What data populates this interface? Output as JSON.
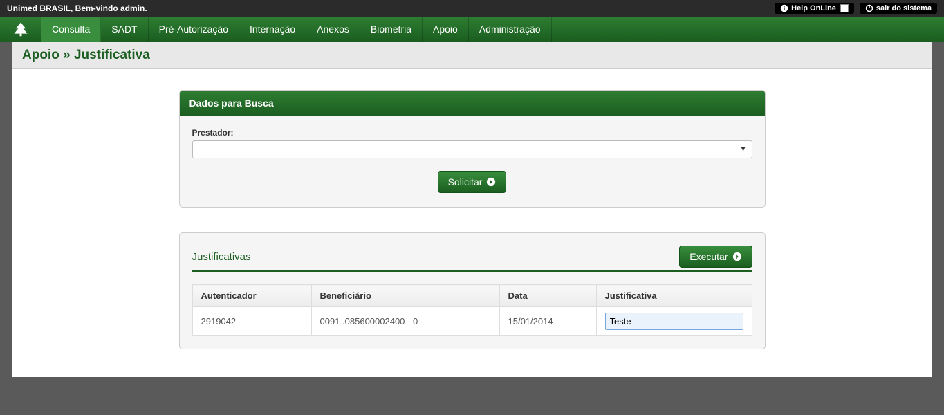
{
  "topbar": {
    "welcome": "Unimed BRASIL, Bem-vindo admin.",
    "help_label": "Help OnLine",
    "exit_label": "sair do sistema"
  },
  "nav": {
    "items": [
      "Consulta",
      "SADT",
      "Pré-Autorização",
      "Internação",
      "Anexos",
      "Biometria",
      "Apoio",
      "Administração"
    ]
  },
  "breadcrumb": "Apoio » Justificativa",
  "search_panel": {
    "title": "Dados para Busca",
    "field_label": "Prestador:",
    "selected_value": "",
    "button_label": "Solicitar"
  },
  "results_panel": {
    "title": "Justificativas",
    "button_label": "Executar",
    "columns": [
      "Autenticador",
      "Beneficiário",
      "Data",
      "Justificativa"
    ],
    "rows": [
      {
        "autenticador": "2919042",
        "beneficiario": "0091 .085600002400 - 0",
        "data": "15/01/2014",
        "justificativa": "Teste"
      }
    ]
  }
}
